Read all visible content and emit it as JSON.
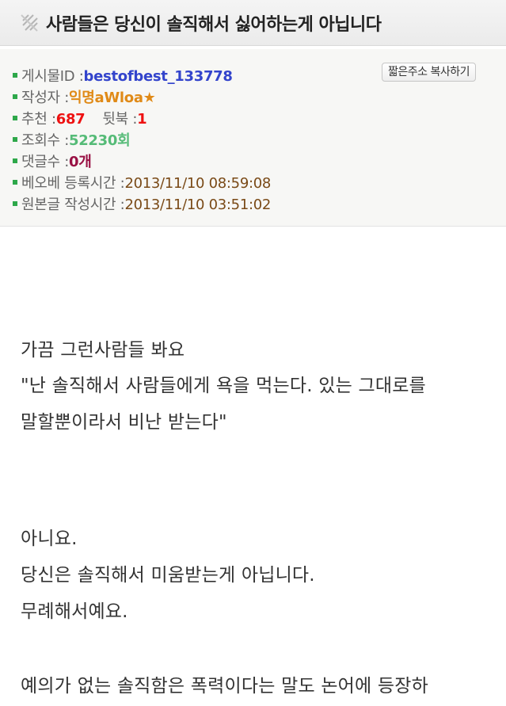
{
  "header": {
    "title": "사람들은 당신이 솔직해서 싫어하는게 아닙니다"
  },
  "meta": {
    "post_id_label": "게시물ID : ",
    "post_id_value": "bestofbest_133778",
    "author_label": "작성자 : ",
    "author_value": "익명aWloa★",
    "recommend_label": "추천 : ",
    "recommend_value": "687",
    "back_label": "뒷북 : ",
    "back_value": "1",
    "views_label": "조회수 : ",
    "views_value": "52230회",
    "comments_label": "댓글수 : ",
    "comments_value": "0개",
    "bob_time_label": "베오베 등록시간 : ",
    "bob_time_value": "2013/11/10 08:59:08",
    "orig_time_label": "원본글 작성시간 : ",
    "orig_time_value": "2013/11/10 03:51:02",
    "copy_button": "짧은주소 복사하기"
  },
  "content": {
    "lines": [
      "가끔 그런사람들 봐요",
      "\"난 솔직해서 사람들에게 욕을 먹는다. 있는 그대로를",
      "말할뿐이라서 비난 받는다\"",
      "아니요.",
      "당신은 솔직해서 미움받는게 아닙니다.",
      "무례해서예요.",
      "예의가 없는 솔직함은 폭력이다는 말도 논어에 등장하"
    ]
  },
  "colors": {
    "bullet": "#2ea84a",
    "post_id": "#3344cc",
    "author": "#e08a17",
    "recommend": "#ee1111",
    "views": "#55bb77",
    "comments": "#991144",
    "time": "#7a4a17"
  }
}
